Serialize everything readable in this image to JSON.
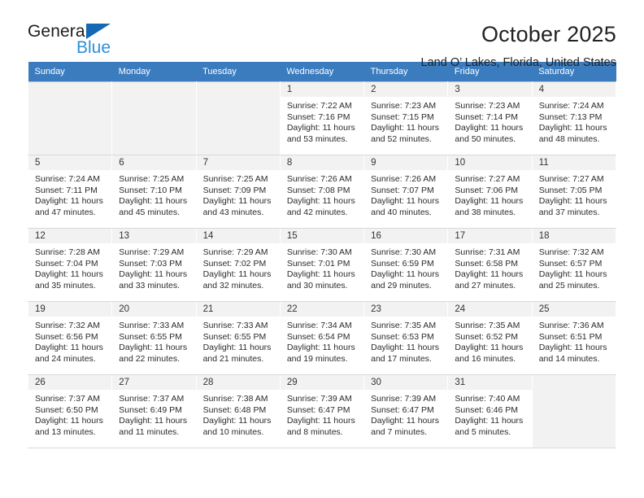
{
  "brand": {
    "name_part1": "General",
    "name_part2": "Blue",
    "triangle_color": "#1668b3",
    "blue_text_color": "#2b8fd9"
  },
  "header": {
    "title": "October 2025",
    "subtitle": "Land O’ Lakes, Florida, United States"
  },
  "calendar": {
    "header_bg": "#3b7cbf",
    "weekday_headers": [
      "Sunday",
      "Monday",
      "Tuesday",
      "Wednesday",
      "Thursday",
      "Friday",
      "Saturday"
    ],
    "weeks": [
      [
        {
          "day": "",
          "empty": true
        },
        {
          "day": "",
          "empty": true
        },
        {
          "day": "",
          "empty": true
        },
        {
          "day": "1",
          "sunrise": "Sunrise: 7:22 AM",
          "sunset": "Sunset: 7:16 PM",
          "daylight": "Daylight: 11 hours and 53 minutes."
        },
        {
          "day": "2",
          "sunrise": "Sunrise: 7:23 AM",
          "sunset": "Sunset: 7:15 PM",
          "daylight": "Daylight: 11 hours and 52 minutes."
        },
        {
          "day": "3",
          "sunrise": "Sunrise: 7:23 AM",
          "sunset": "Sunset: 7:14 PM",
          "daylight": "Daylight: 11 hours and 50 minutes."
        },
        {
          "day": "4",
          "sunrise": "Sunrise: 7:24 AM",
          "sunset": "Sunset: 7:13 PM",
          "daylight": "Daylight: 11 hours and 48 minutes."
        }
      ],
      [
        {
          "day": "5",
          "sunrise": "Sunrise: 7:24 AM",
          "sunset": "Sunset: 7:11 PM",
          "daylight": "Daylight: 11 hours and 47 minutes."
        },
        {
          "day": "6",
          "sunrise": "Sunrise: 7:25 AM",
          "sunset": "Sunset: 7:10 PM",
          "daylight": "Daylight: 11 hours and 45 minutes."
        },
        {
          "day": "7",
          "sunrise": "Sunrise: 7:25 AM",
          "sunset": "Sunset: 7:09 PM",
          "daylight": "Daylight: 11 hours and 43 minutes."
        },
        {
          "day": "8",
          "sunrise": "Sunrise: 7:26 AM",
          "sunset": "Sunset: 7:08 PM",
          "daylight": "Daylight: 11 hours and 42 minutes."
        },
        {
          "day": "9",
          "sunrise": "Sunrise: 7:26 AM",
          "sunset": "Sunset: 7:07 PM",
          "daylight": "Daylight: 11 hours and 40 minutes."
        },
        {
          "day": "10",
          "sunrise": "Sunrise: 7:27 AM",
          "sunset": "Sunset: 7:06 PM",
          "daylight": "Daylight: 11 hours and 38 minutes."
        },
        {
          "day": "11",
          "sunrise": "Sunrise: 7:27 AM",
          "sunset": "Sunset: 7:05 PM",
          "daylight": "Daylight: 11 hours and 37 minutes."
        }
      ],
      [
        {
          "day": "12",
          "sunrise": "Sunrise: 7:28 AM",
          "sunset": "Sunset: 7:04 PM",
          "daylight": "Daylight: 11 hours and 35 minutes."
        },
        {
          "day": "13",
          "sunrise": "Sunrise: 7:29 AM",
          "sunset": "Sunset: 7:03 PM",
          "daylight": "Daylight: 11 hours and 33 minutes."
        },
        {
          "day": "14",
          "sunrise": "Sunrise: 7:29 AM",
          "sunset": "Sunset: 7:02 PM",
          "daylight": "Daylight: 11 hours and 32 minutes."
        },
        {
          "day": "15",
          "sunrise": "Sunrise: 7:30 AM",
          "sunset": "Sunset: 7:01 PM",
          "daylight": "Daylight: 11 hours and 30 minutes."
        },
        {
          "day": "16",
          "sunrise": "Sunrise: 7:30 AM",
          "sunset": "Sunset: 6:59 PM",
          "daylight": "Daylight: 11 hours and 29 minutes."
        },
        {
          "day": "17",
          "sunrise": "Sunrise: 7:31 AM",
          "sunset": "Sunset: 6:58 PM",
          "daylight": "Daylight: 11 hours and 27 minutes."
        },
        {
          "day": "18",
          "sunrise": "Sunrise: 7:32 AM",
          "sunset": "Sunset: 6:57 PM",
          "daylight": "Daylight: 11 hours and 25 minutes."
        }
      ],
      [
        {
          "day": "19",
          "sunrise": "Sunrise: 7:32 AM",
          "sunset": "Sunset: 6:56 PM",
          "daylight": "Daylight: 11 hours and 24 minutes."
        },
        {
          "day": "20",
          "sunrise": "Sunrise: 7:33 AM",
          "sunset": "Sunset: 6:55 PM",
          "daylight": "Daylight: 11 hours and 22 minutes."
        },
        {
          "day": "21",
          "sunrise": "Sunrise: 7:33 AM",
          "sunset": "Sunset: 6:55 PM",
          "daylight": "Daylight: 11 hours and 21 minutes."
        },
        {
          "day": "22",
          "sunrise": "Sunrise: 7:34 AM",
          "sunset": "Sunset: 6:54 PM",
          "daylight": "Daylight: 11 hours and 19 minutes."
        },
        {
          "day": "23",
          "sunrise": "Sunrise: 7:35 AM",
          "sunset": "Sunset: 6:53 PM",
          "daylight": "Daylight: 11 hours and 17 minutes."
        },
        {
          "day": "24",
          "sunrise": "Sunrise: 7:35 AM",
          "sunset": "Sunset: 6:52 PM",
          "daylight": "Daylight: 11 hours and 16 minutes."
        },
        {
          "day": "25",
          "sunrise": "Sunrise: 7:36 AM",
          "sunset": "Sunset: 6:51 PM",
          "daylight": "Daylight: 11 hours and 14 minutes."
        }
      ],
      [
        {
          "day": "26",
          "sunrise": "Sunrise: 7:37 AM",
          "sunset": "Sunset: 6:50 PM",
          "daylight": "Daylight: 11 hours and 13 minutes."
        },
        {
          "day": "27",
          "sunrise": "Sunrise: 7:37 AM",
          "sunset": "Sunset: 6:49 PM",
          "daylight": "Daylight: 11 hours and 11 minutes."
        },
        {
          "day": "28",
          "sunrise": "Sunrise: 7:38 AM",
          "sunset": "Sunset: 6:48 PM",
          "daylight": "Daylight: 11 hours and 10 minutes."
        },
        {
          "day": "29",
          "sunrise": "Sunrise: 7:39 AM",
          "sunset": "Sunset: 6:47 PM",
          "daylight": "Daylight: 11 hours and 8 minutes."
        },
        {
          "day": "30",
          "sunrise": "Sunrise: 7:39 AM",
          "sunset": "Sunset: 6:47 PM",
          "daylight": "Daylight: 11 hours and 7 minutes."
        },
        {
          "day": "31",
          "sunrise": "Sunrise: 7:40 AM",
          "sunset": "Sunset: 6:46 PM",
          "daylight": "Daylight: 11 hours and 5 minutes."
        },
        {
          "day": "",
          "empty": true
        }
      ]
    ]
  }
}
